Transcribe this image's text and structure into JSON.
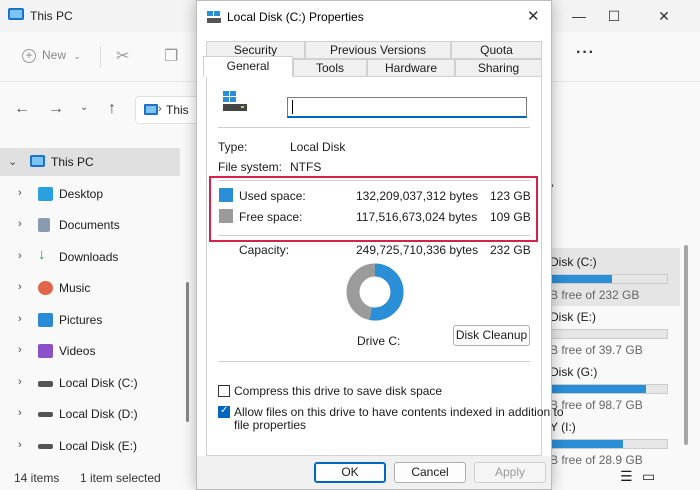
{
  "explorer": {
    "title": "This PC",
    "toolbar": {
      "new_label": "New"
    },
    "address": {
      "text": "This"
    },
    "sidebar": [
      {
        "label": "This PC",
        "icon": "this-pc-icon",
        "selected": true,
        "expanded": true
      },
      {
        "label": "Desktop",
        "icon": "desktop-icon"
      },
      {
        "label": "Documents",
        "icon": "documents-icon"
      },
      {
        "label": "Downloads",
        "icon": "downloads-icon"
      },
      {
        "label": "Music",
        "icon": "music-icon"
      },
      {
        "label": "Pictures",
        "icon": "pictures-icon"
      },
      {
        "label": "Videos",
        "icon": "videos-icon"
      },
      {
        "label": "Local Disk (C:)",
        "icon": "local-disk-c-icon"
      },
      {
        "label": "Local Disk (D:)",
        "icon": "local-disk-icon"
      },
      {
        "label": "Local Disk (E:)",
        "icon": "local-disk-icon"
      }
    ],
    "drives": [
      {
        "name": "Disk (C:)",
        "free": "B free of 232 GB",
        "used_fraction": 0.53,
        "selected": true
      },
      {
        "name": "Disk (E:)",
        "free": "B free of 39.7 GB",
        "used_fraction": 0.0
      },
      {
        "name": "Disk (G:)",
        "free": "B free of 98.7 GB",
        "used_fraction": 0.82
      },
      {
        "name": "Y (I:)",
        "free": "B free of 28.9 GB",
        "used_fraction": 0.62
      }
    ],
    "status": {
      "items": "14 items",
      "selected": "1 item selected"
    }
  },
  "dialog": {
    "title": "Local Disk (C:) Properties",
    "tabs_top": [
      "Security",
      "Previous Versions",
      "Quota"
    ],
    "tabs_bottom": [
      "General",
      "Tools",
      "Hardware",
      "Sharing"
    ],
    "active_tab": "General",
    "name_value": "",
    "type_label": "Type:",
    "type_value": "Local Disk",
    "fs_label": "File system:",
    "fs_value": "NTFS",
    "used_label": "Used space:",
    "used_bytes": "132,209,037,312 bytes",
    "used_gb": "123 GB",
    "free_label": "Free space:",
    "free_bytes": "117,516,673,024 bytes",
    "free_gb": "109 GB",
    "capacity_label": "Capacity:",
    "capacity_bytes": "249,725,710,336 bytes",
    "capacity_gb": "232 GB",
    "drive_label": "Drive C:",
    "cleanup_label": "Disk Cleanup",
    "compress_label": "Compress this drive to save disk space",
    "compress_checked": false,
    "index_label_line1": "Allow files on this drive to have contents indexed in addition to",
    "index_label_line2": "file properties",
    "index_checked": true,
    "ok_label": "OK",
    "cancel_label": "Cancel",
    "apply_label": "Apply",
    "used_fraction": 0.529,
    "colors": {
      "used": "#2a8fd6",
      "free": "#9b9b9b",
      "accent": "#0067c0",
      "highlight": "#d6224a"
    }
  }
}
